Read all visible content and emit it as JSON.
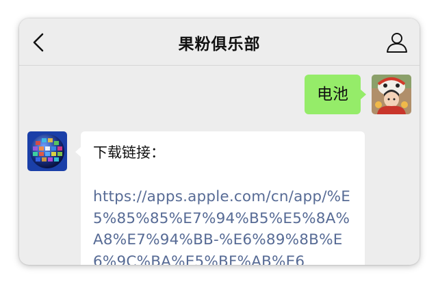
{
  "chat": {
    "title": "果粉俱乐部"
  },
  "messages": {
    "outgoing": {
      "text": "电池"
    },
    "incoming": {
      "label": "下载链接：",
      "link": "https://apps.apple.com/cn/app/%E5%85%85%E7%94%B5%E5%8A%A8%E7%94%BB-%E6%89%8B%E6%9C%BA%E5%BF%AB%E6"
    }
  },
  "colors": {
    "background": "#ededed",
    "outgoing_bubble": "#95ec69",
    "incoming_bubble": "#ffffff",
    "link": "#576b95"
  },
  "icons": {
    "back": "chevron-left-icon",
    "profile": "person-icon"
  }
}
